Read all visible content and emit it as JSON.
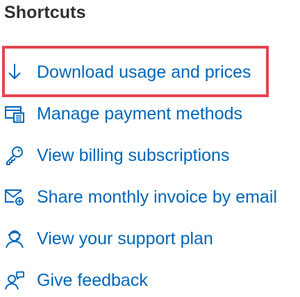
{
  "section_title": "Shortcuts",
  "shortcuts": [
    {
      "label": "Download usage and prices",
      "icon": "download-icon"
    },
    {
      "label": "Manage payment methods",
      "icon": "payment-card-icon"
    },
    {
      "label": "View billing subscriptions",
      "icon": "key-icon"
    },
    {
      "label": "Share monthly invoice by email",
      "icon": "mail-share-icon"
    },
    {
      "label": "View your support plan",
      "icon": "support-person-icon"
    },
    {
      "label": "Give feedback",
      "icon": "feedback-person-icon"
    }
  ],
  "colors": {
    "link": "#0067b8",
    "focus_outline": "#e5444f",
    "text": "#323130"
  }
}
